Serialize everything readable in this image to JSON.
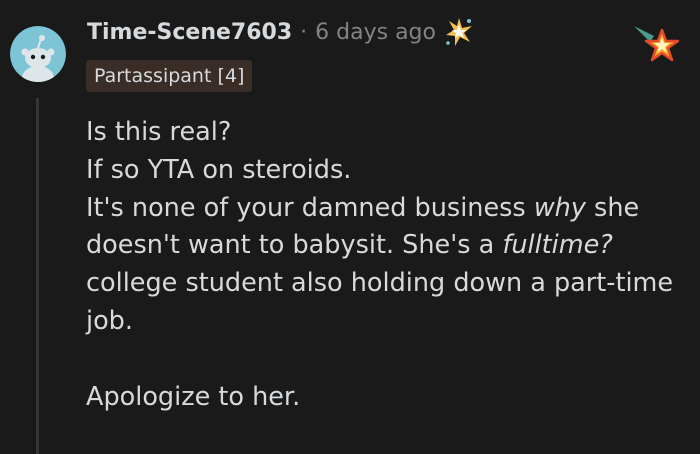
{
  "comment": {
    "author": "Time-Scene7603",
    "separator": "·",
    "timestamp": "6 days ago",
    "flair": "Partassipant [4]",
    "lines": {
      "l1": "Is this real?",
      "l2": "If so YTA on steroids.",
      "l3_a": "It's none of your damned business ",
      "l3_em": "why",
      "l3_b": " she doesn't want to babysit. She's a ",
      "l3_em2": "fulltime?",
      "l3_c": " college student also holding down a part-time job.",
      "l4": "Apologize to her."
    }
  },
  "icons": {
    "avatar": "snoo-avatar-icon",
    "award": "sparkle-award-icon",
    "star": "shooting-star-award-icon"
  },
  "colors": {
    "background": "#1a1a1b",
    "text": "#d7dadc",
    "muted": "#818384",
    "flair_bg": "#3a2c26",
    "avatar_bg": "#7cc4d6"
  }
}
